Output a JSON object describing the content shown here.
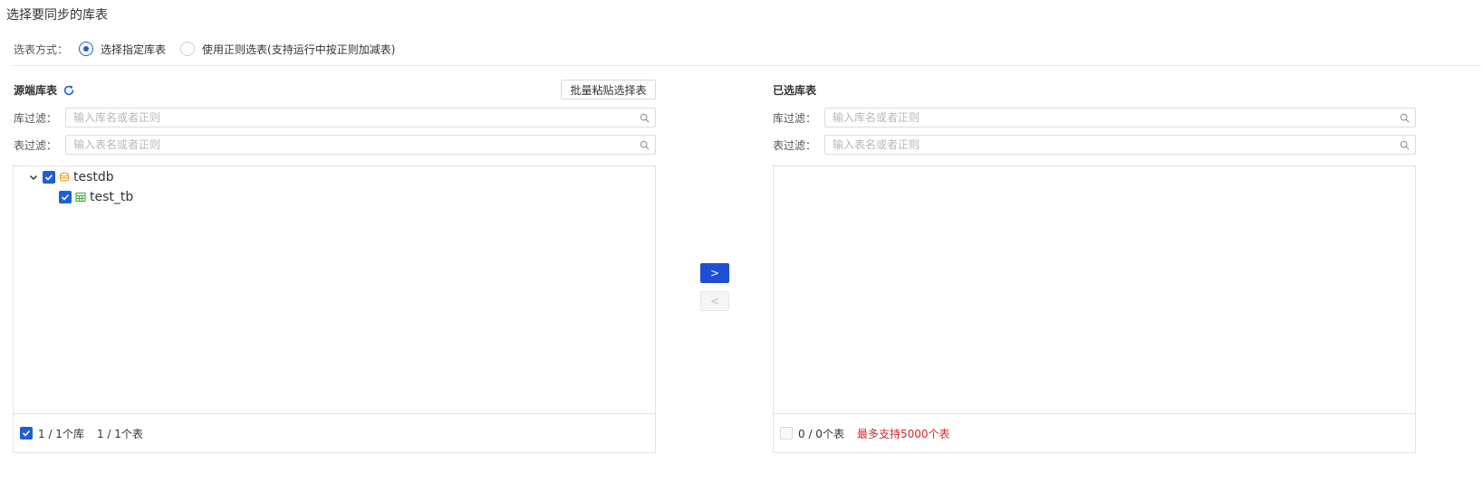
{
  "page": {
    "title": "选择要同步的库表"
  },
  "mode": {
    "label": "选表方式：",
    "options": [
      {
        "label": "选择指定库表",
        "checked": true
      },
      {
        "label": "使用正则选表(支持运行中按正则加减表)",
        "checked": false
      }
    ]
  },
  "source": {
    "title": "源端库表",
    "paste_button": "批量粘贴选择表",
    "db_filter": {
      "label": "库过滤：",
      "placeholder": "输入库名或者正则"
    },
    "table_filter": {
      "label": "表过滤：",
      "placeholder": "输入表名或者正则"
    },
    "tree": {
      "database": {
        "name": "testdb",
        "checked": true,
        "expanded": true
      },
      "table": {
        "name": "test_tb",
        "checked": true
      }
    },
    "footer": {
      "db_count": "1 / 1个库",
      "table_count": "1 / 1个表",
      "checked": true
    }
  },
  "transfer": {
    "to_right": ">",
    "to_left": "<"
  },
  "selected": {
    "title": "已选库表",
    "db_filter": {
      "label": "库过滤：",
      "placeholder": "输入库名或者正则"
    },
    "table_filter": {
      "label": "表过滤：",
      "placeholder": "输入表名或者正则"
    },
    "footer": {
      "table_count": "0 / 0个表",
      "limit": "最多支持5000个表",
      "checked": false
    }
  },
  "colors": {
    "primary": "#1f5ed8",
    "button": "#1f4fd6",
    "warning": "#d9262a",
    "db_icon": "#f0a020",
    "table_icon": "#3cb043"
  },
  "icons": {
    "refresh": "refresh-icon",
    "search": "search-icon",
    "caret": "chevron-down-icon",
    "database": "database-icon",
    "table": "table-icon"
  }
}
